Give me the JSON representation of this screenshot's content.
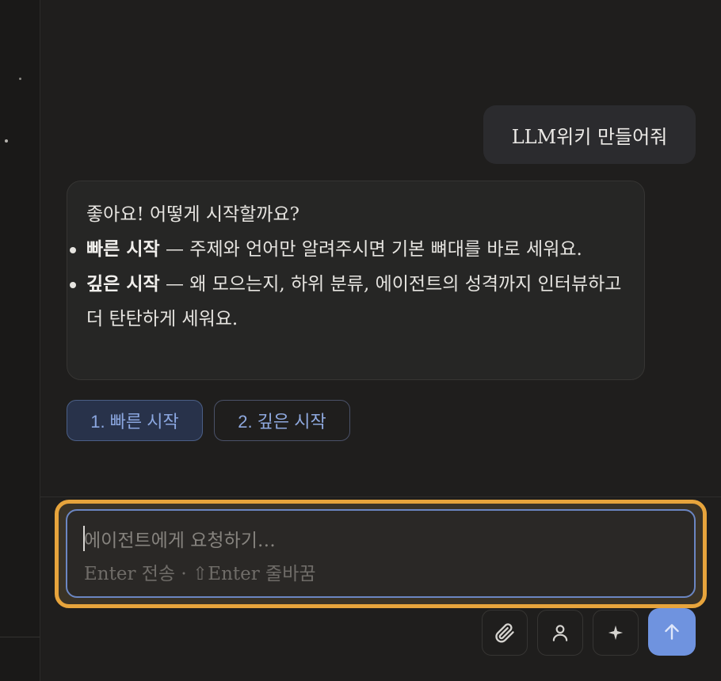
{
  "conversation": {
    "user_message": "LLM위키 만들어줘",
    "assistant": {
      "intro": "좋아요! 어떻게 시작할까요?",
      "options": [
        {
          "title": "빠른 시작",
          "separator": " — ",
          "text": "주제와 언어만 알려주시면 기본 뼈대를 바로 세워요."
        },
        {
          "title": "깊은 시작",
          "separator": " — ",
          "text": "왜 모으는지, 하위 분류, 에이전트의 성격까지 인터뷰하고 더 탄탄하게 세워요."
        }
      ]
    },
    "choices": [
      "1. 빠른 시작",
      "2. 깊은 시작"
    ]
  },
  "input": {
    "placeholder": "에이전트에게 요청하기…",
    "hint": "Enter 전송 · ⇧Enter 줄바꿈"
  },
  "toolbar": {
    "icons": [
      "paperclip-icon",
      "person-icon",
      "sparkle-icon"
    ],
    "send_icon": "arrow-up-icon"
  },
  "colors": {
    "background": "#1f1e1d",
    "accent": "#6f93df",
    "focus_ring": "#e7a43c"
  }
}
